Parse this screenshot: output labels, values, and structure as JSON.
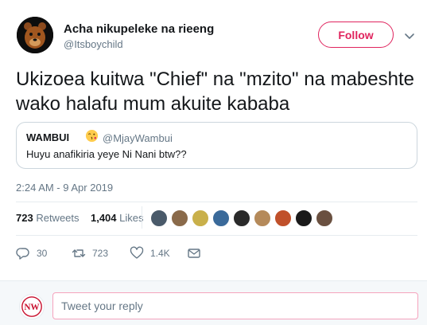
{
  "author": {
    "display_name": "Acha nikupeleke na rieeng",
    "handle": "@Itsboychild",
    "avatar_icon": "bear-avatar-icon"
  },
  "header": {
    "follow_label": "Follow",
    "more_icon": "chevron-down-icon",
    "accent_color": "#e0245e"
  },
  "tweet": {
    "text": "Ukizoea kuitwa \"Chief\" na \"mzito\" na mabeshte wako halafu mum akuite kababa",
    "timestamp": "2:24 AM - 9 Apr 2019"
  },
  "quoted_tweet": {
    "display_name": "WAMBUI",
    "emoji_icon": "kissing-face-emoji-icon",
    "handle": "@MjayWambui",
    "text": "Huyu anafikiria yeye Ni Nani btw??"
  },
  "stats": {
    "retweets_count": "723",
    "retweets_label": "Retweets",
    "likes_count": "1,404",
    "likes_label": "Likes",
    "likers": [
      {
        "name": "liker-avatar-1",
        "color": "#4a5a6a"
      },
      {
        "name": "liker-avatar-2",
        "color": "#8a6a4a"
      },
      {
        "name": "liker-avatar-3",
        "color": "#c9b04a"
      },
      {
        "name": "liker-avatar-4",
        "color": "#3a6a9a"
      },
      {
        "name": "liker-avatar-5",
        "color": "#2a2a2a"
      },
      {
        "name": "liker-avatar-6",
        "color": "#b58a5a"
      },
      {
        "name": "liker-avatar-7",
        "color": "#c0502a"
      },
      {
        "name": "liker-avatar-8",
        "color": "#1a1a1a"
      },
      {
        "name": "liker-avatar-9",
        "color": "#6a5040"
      }
    ]
  },
  "actions": {
    "reply_count": "30",
    "retweet_count": "723",
    "like_count": "1.4K"
  },
  "reply": {
    "placeholder": "Tweet your reply",
    "avatar_initials": "NW"
  }
}
